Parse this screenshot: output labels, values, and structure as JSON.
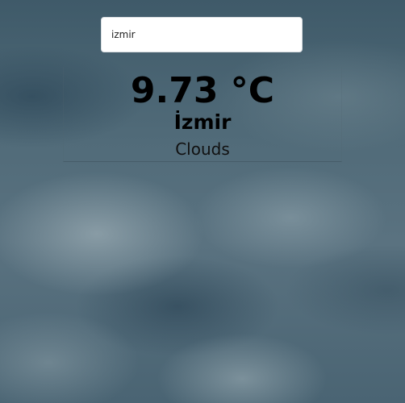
{
  "search": {
    "value": "izmir",
    "placeholder": ""
  },
  "weather": {
    "temperature": "9.73 °C",
    "city": "İzmir",
    "condition": "Clouds"
  },
  "colors": {
    "background": "#4b6472",
    "input_background": "#ffffff",
    "text": "#000000"
  }
}
